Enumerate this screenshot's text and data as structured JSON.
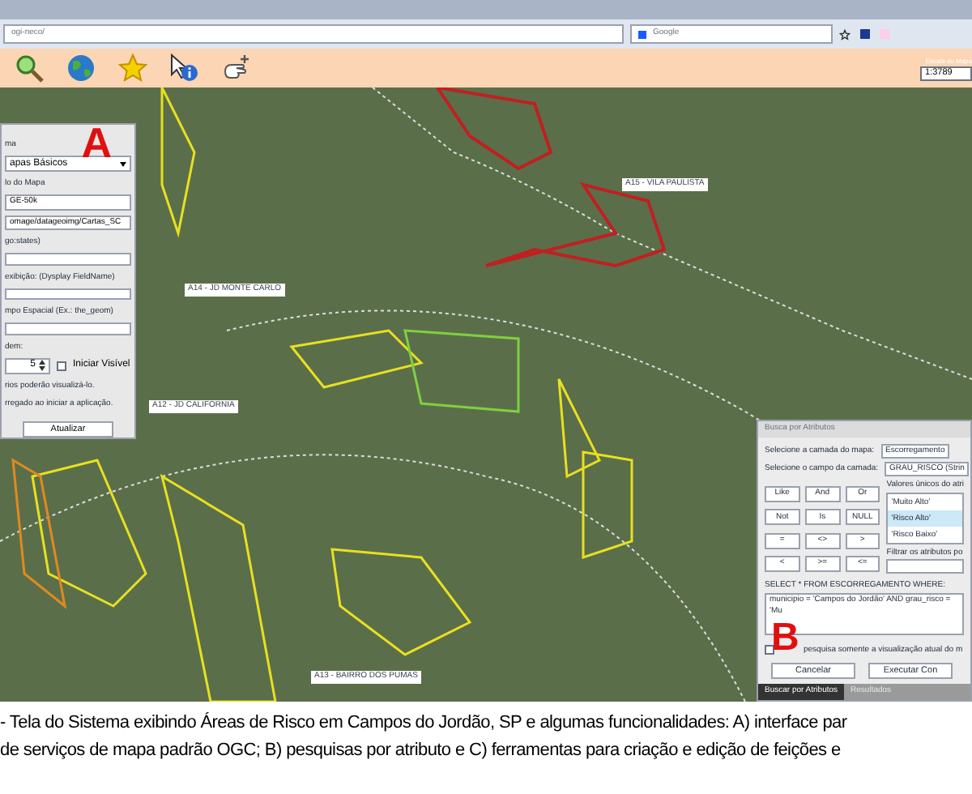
{
  "browser": {
    "url": "ogi-neco/",
    "search_placeholder": "Google"
  },
  "toolbar": {
    "tools": [
      {
        "kind": "zoom"
      },
      {
        "kind": "globe"
      },
      {
        "kind": "star"
      },
      {
        "kind": "info"
      },
      {
        "kind": "hand"
      }
    ],
    "scale_label": "Escala do Mapa",
    "scale_value": "1:3789"
  },
  "map": {
    "district_labels": [
      {
        "text": "A15 - VILA PAULISTA"
      },
      {
        "text": "A14 - JD MONTE CARLO"
      },
      {
        "text": "A12 - JD CALIFORNIA"
      },
      {
        "text": "A13 - BAIRRO DOS PUMAS"
      }
    ]
  },
  "layer_panel": {
    "marker": "A",
    "fields": [
      {
        "kind": "label",
        "text": "ma"
      },
      {
        "kind": "select",
        "value": "apas Básicos"
      },
      {
        "kind": "label",
        "text": "lo do Mapa"
      },
      {
        "kind": "input",
        "value": "GE-50k"
      },
      {
        "kind": "input",
        "value": "omage/datageoimg/Cartas_SC"
      },
      {
        "kind": "label",
        "text": "go:states)"
      },
      {
        "kind": "input"
      },
      {
        "kind": "label",
        "text": "exibição: (Dysplay FieldName)"
      },
      {
        "kind": "input"
      },
      {
        "kind": "label",
        "text": "mpo Espacial (Ex.: the_geom)"
      },
      {
        "kind": "input"
      },
      {
        "kind": "label",
        "text": "dem:"
      },
      {
        "kind": "spinner",
        "value": "5",
        "checkbox_label": "Iniciar Visível",
        "checked": false
      },
      {
        "kind": "label",
        "text": "rios poderão visualizá-lo."
      },
      {
        "kind": "label",
        "text": "rregado ao iniciar a aplicação."
      }
    ],
    "button": "Atualizar"
  },
  "search_panel": {
    "marker": "B",
    "title": "Busca por Atributos",
    "layer_label": "Selecione a camada do mapa:",
    "layer_value": "Escorregamento",
    "field_label": "Selecione o campo da camada:",
    "field_value": "GRAU_RISCO (Strin",
    "operators": [
      "Like",
      "And",
      "Or",
      "Not",
      "Is",
      "NULL",
      "=",
      "<>",
      ">",
      "<",
      ">=",
      "<="
    ],
    "values_label": "Valores únicos do atri",
    "values": [
      {
        "text": "'Muito Alto'",
        "selected": false
      },
      {
        "text": "'Risco Alto'",
        "selected": true
      },
      {
        "text": "'Risco Baixo'",
        "selected": false
      }
    ],
    "filter_label": "Filtrar os atributos po",
    "query_label": "SELECT * FROM ESCORREGAMENTO WHERE:",
    "query": "municipio = 'Campos do Jordão' AND grau_risco = 'Mu",
    "current_view_label": "pesquisa somente a visualização atual do m",
    "current_view_checked": false,
    "buttons": [
      "Cancelar",
      "Executar Con"
    ],
    "tabs": [
      {
        "label": "Buscar por Atributos",
        "selected": true
      },
      {
        "label": "Resultados",
        "selected": false
      }
    ]
  },
  "caption": [
    "- Tela do Sistema exibindo Áreas de Risco em Campos do Jordão, SP e algumas funcionalidades: A) interface par",
    "de serviços de mapa padrão OGC;  B) pesquisas por atributo e C) ferramentas para criação e edição de feições e"
  ]
}
